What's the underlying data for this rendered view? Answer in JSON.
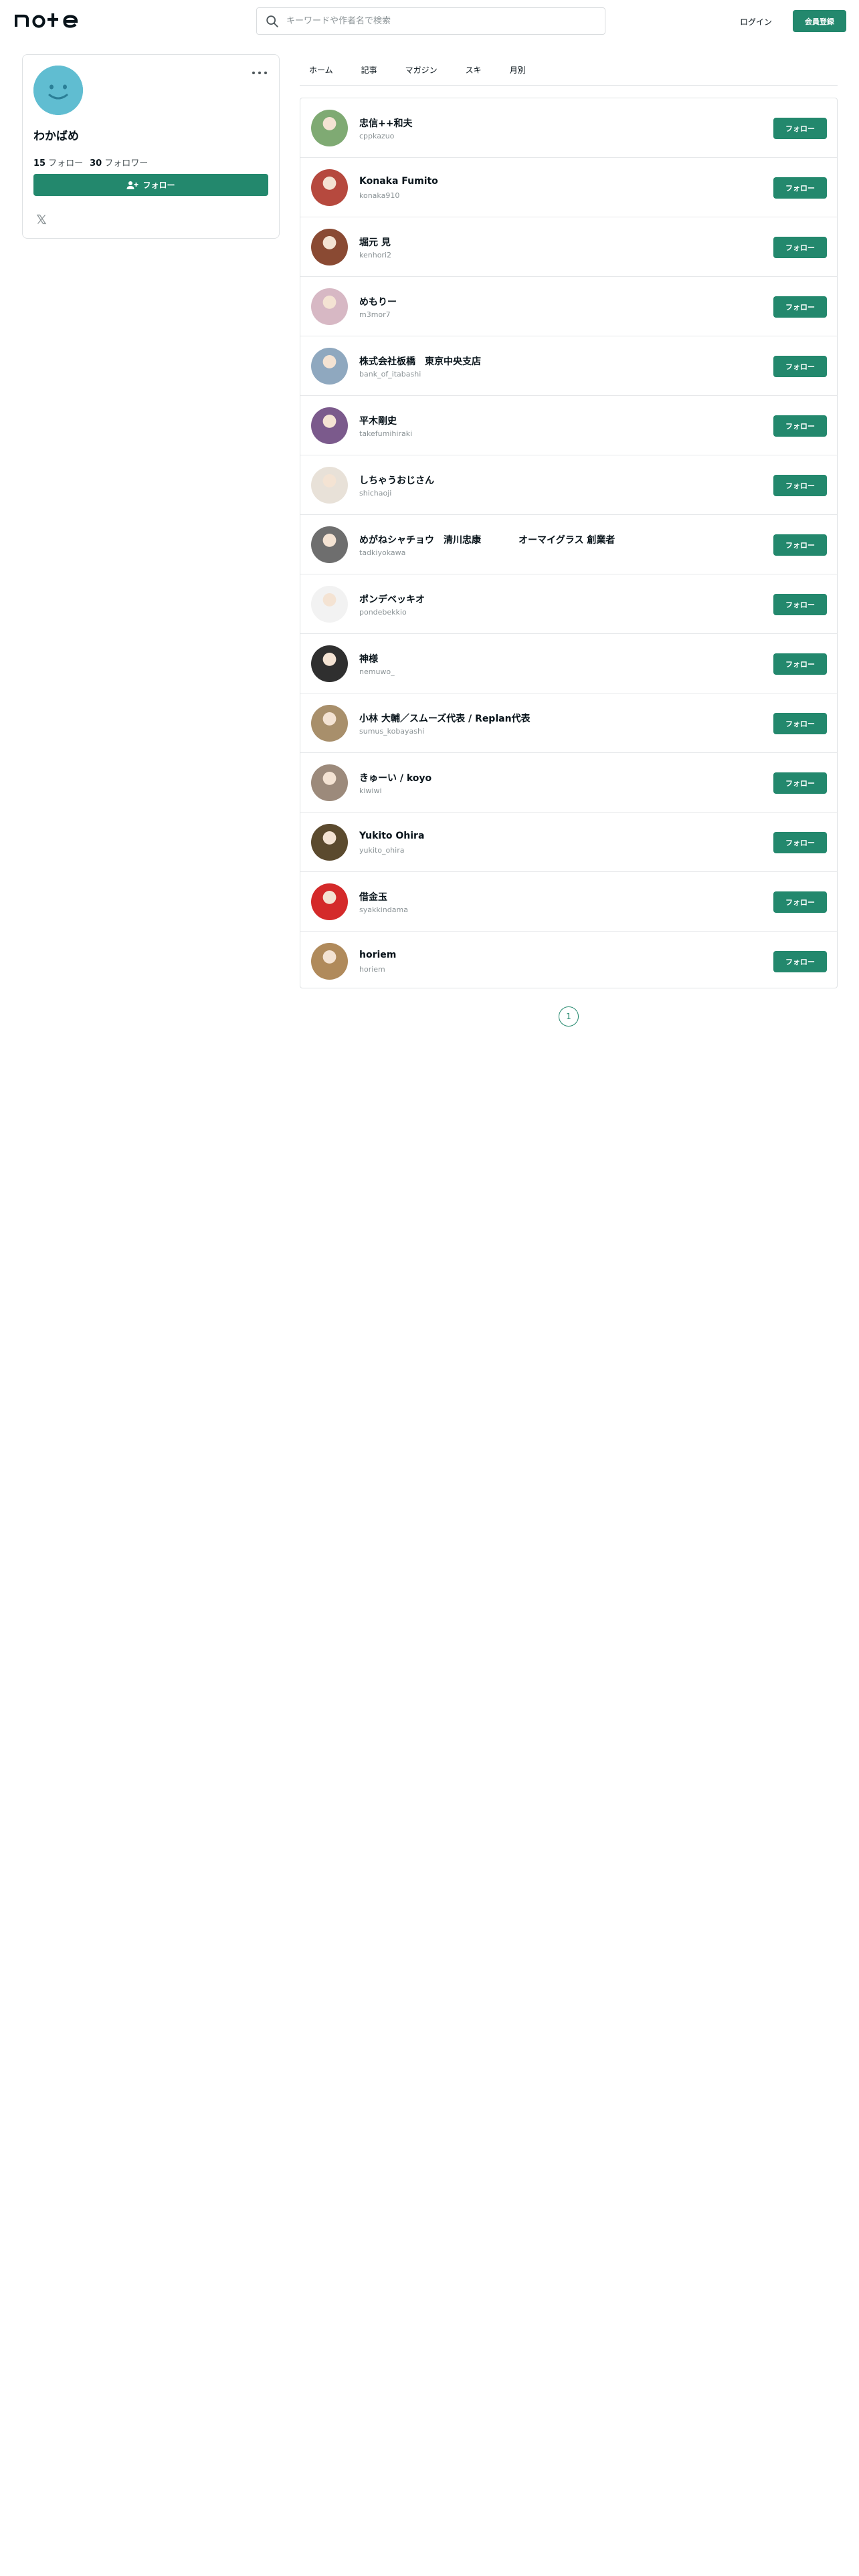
{
  "header": {
    "logo_text": "note",
    "search_placeholder": "キーワードや作者名で検索",
    "login_label": "ログイン",
    "signup_label": "会員登録"
  },
  "profile": {
    "name": "わかばめ",
    "following_count": "15",
    "following_label": "フォロー",
    "followers_count": "30",
    "followers_label": "フォロワー",
    "follow_label": "フォロー",
    "avatar_color": "#60bdd1"
  },
  "tabs": [
    {
      "label": "ホーム"
    },
    {
      "label": "記事"
    },
    {
      "label": "マガジン"
    },
    {
      "label": "スキ"
    },
    {
      "label": "月別"
    }
  ],
  "follow_button_label": "フォロー",
  "users": [
    {
      "name": "忠信++和夫",
      "id": "cppkazuo",
      "avatar_color": "#7faa73"
    },
    {
      "name": "Konaka Fumito",
      "id": "konaka910",
      "avatar_color": "#b6493e"
    },
    {
      "name": "堀元 見",
      "id": "kenhori2",
      "avatar_color": "#8a4a33"
    },
    {
      "name": "めもりー",
      "id": "m3mor7",
      "avatar_color": "#d7b8c4"
    },
    {
      "name": "株式会社板橋　東京中央支店",
      "id": "bank_of_itabashi",
      "avatar_color": "#8fa8bf"
    },
    {
      "name": "平木剛史",
      "id": "takefumihiraki",
      "avatar_color": "#7b5a8c"
    },
    {
      "name": "しちゃうおじさん",
      "id": "shichaoji",
      "avatar_color": "#e8e1d8"
    },
    {
      "name": "めがねシャチョウ　清川忠康　　　　オーマイグラス 創業者",
      "id": "tadkiyokawa",
      "avatar_color": "#6e6e6e"
    },
    {
      "name": "ポンデベッキオ",
      "id": "pondebekkio",
      "avatar_color": "#f2f2f2"
    },
    {
      "name": "神様",
      "id": "nemuwo_",
      "avatar_color": "#2f2f2f"
    },
    {
      "name": "小林 大輔／スムーズ代表 / Replan代表",
      "id": "sumus_kobayashi",
      "avatar_color": "#a88f6b"
    },
    {
      "name": "きゅーい / koyo",
      "id": "kiwiwi",
      "avatar_color": "#9c8a7b"
    },
    {
      "name": "Yukito Ohira",
      "id": "yukito_ohira",
      "avatar_color": "#5b4a2e"
    },
    {
      "name": "借金玉",
      "id": "syakkindama",
      "avatar_color": "#d42a2a"
    },
    {
      "name": "horiem",
      "id": "horiem",
      "avatar_color": "#b08a5b"
    }
  ],
  "pagination": {
    "current": "1"
  },
  "colors": {
    "accent": "#23886d",
    "border": "#dfe2e4",
    "muted": "#8b9396"
  }
}
